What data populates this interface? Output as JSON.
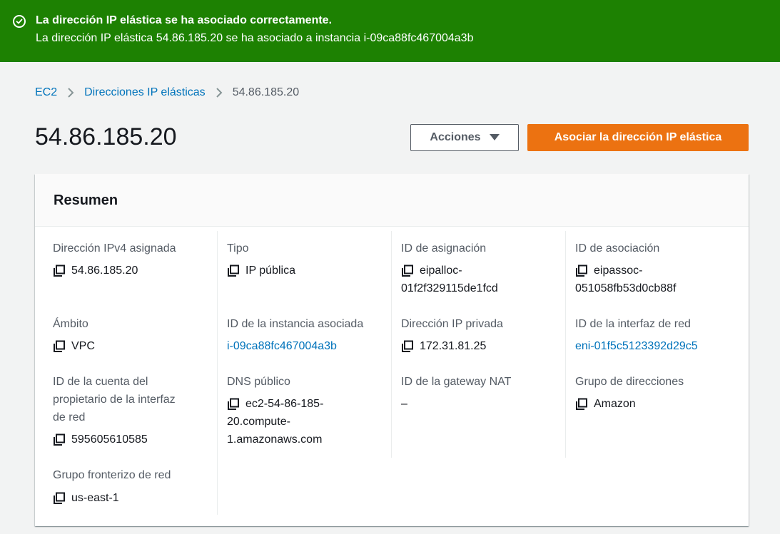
{
  "flash": {
    "title": "La dirección IP elástica se ha asociado correctamente.",
    "message": "La dirección IP elástica 54.86.185.20 se ha asociado a instancia i-09ca88fc467004a3b",
    "color": "#1d8102"
  },
  "breadcrumb": {
    "items": [
      "EC2",
      "Direcciones IP elásticas",
      "54.86.185.20"
    ]
  },
  "header": {
    "title": "54.86.185.20",
    "actions_label": "Acciones",
    "primary_label": "Asociar la dirección IP elástica",
    "primary_color": "#ec7211"
  },
  "summary": {
    "title": "Resumen",
    "fields": {
      "ipv4": {
        "label": "Dirección IPv4 asignada",
        "value": "54.86.185.20"
      },
      "tipo": {
        "label": "Tipo",
        "value": "IP pública"
      },
      "asignacion": {
        "label": "ID de asignación",
        "value": "eipalloc-01f2f329115de1fcd",
        "line1": "eipalloc-",
        "line2": "01f2f329115de1fcd"
      },
      "asociacion": {
        "label": "ID de asociación",
        "value": "eipassoc-051058fb53d0cb88f",
        "line1": "eipassoc-",
        "line2": "051058fb53d0cb88f"
      },
      "ambito": {
        "label": "Ámbito",
        "value": "VPC"
      },
      "instancia": {
        "label": "ID de la instancia asociada",
        "value": "i-09ca88fc467004a3b"
      },
      "ip_privada": {
        "label": "Dirección IP privada",
        "value": "172.31.81.25"
      },
      "interfaz": {
        "label": "ID de la interfaz de red",
        "value": "eni-01f5c5123392d29c5"
      },
      "cuenta": {
        "label": "ID de la cuenta del propietario de la interfaz de red",
        "label_lines": [
          "ID de la cuenta del",
          "propietario de la interfaz",
          "de red"
        ],
        "value": "595605610585"
      },
      "dns": {
        "label": "DNS público",
        "value": "ec2-54-86-185-20.compute-1.amazonaws.com",
        "value_lines": [
          "ec2-54-86-185-",
          "20.compute-",
          "1.amazonaws.com"
        ]
      },
      "nat": {
        "label": "ID de la gateway NAT",
        "value": "–"
      },
      "grupo": {
        "label": "Grupo de direcciones",
        "value": "Amazon"
      },
      "fronterizo": {
        "label": "Grupo fronterizo de red",
        "value": "us-east-1"
      }
    }
  },
  "icons": {
    "flash": "check-circle-icon",
    "breadcrumb_sep": "chevron-right-icon",
    "actions_caret": "caret-down-icon",
    "copy": "copy-icon"
  }
}
